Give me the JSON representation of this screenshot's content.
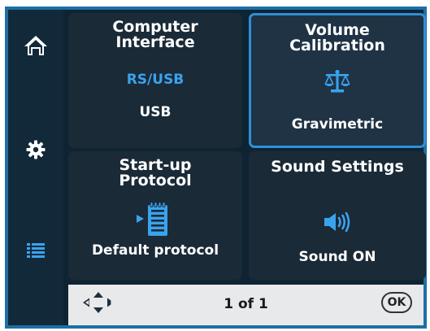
{
  "sidebar": {
    "items": [
      {
        "icon": "home-icon"
      },
      {
        "icon": "gear-icon"
      },
      {
        "icon": "list-icon"
      }
    ]
  },
  "tiles": {
    "computer_interface": {
      "title_line1": "Computer",
      "title_line2": "Interface",
      "options": "RS/USB",
      "value": "USB"
    },
    "volume_calibration": {
      "title_line1": "Volume",
      "title_line2": "Calibration",
      "icon": "scale-icon",
      "value": "Gravimetric"
    },
    "startup_protocol": {
      "title_line1": "Start-up",
      "title_line2": "Protocol",
      "icon": "protocol-notepad-icon",
      "value": "Default protocol"
    },
    "sound_settings": {
      "title": "Sound Settings",
      "icon": "speaker-icon",
      "value": "Sound ON"
    }
  },
  "bottom_bar": {
    "nav_icon": "navigation-arrows-icon",
    "page_indicator": "1 of 1",
    "ok_label": "OK"
  },
  "colors": {
    "accent": "#3aa3ee",
    "selected_border": "#2f8fd6",
    "frame": "#1d6fa5",
    "tile_bg": "#1a2a37"
  }
}
